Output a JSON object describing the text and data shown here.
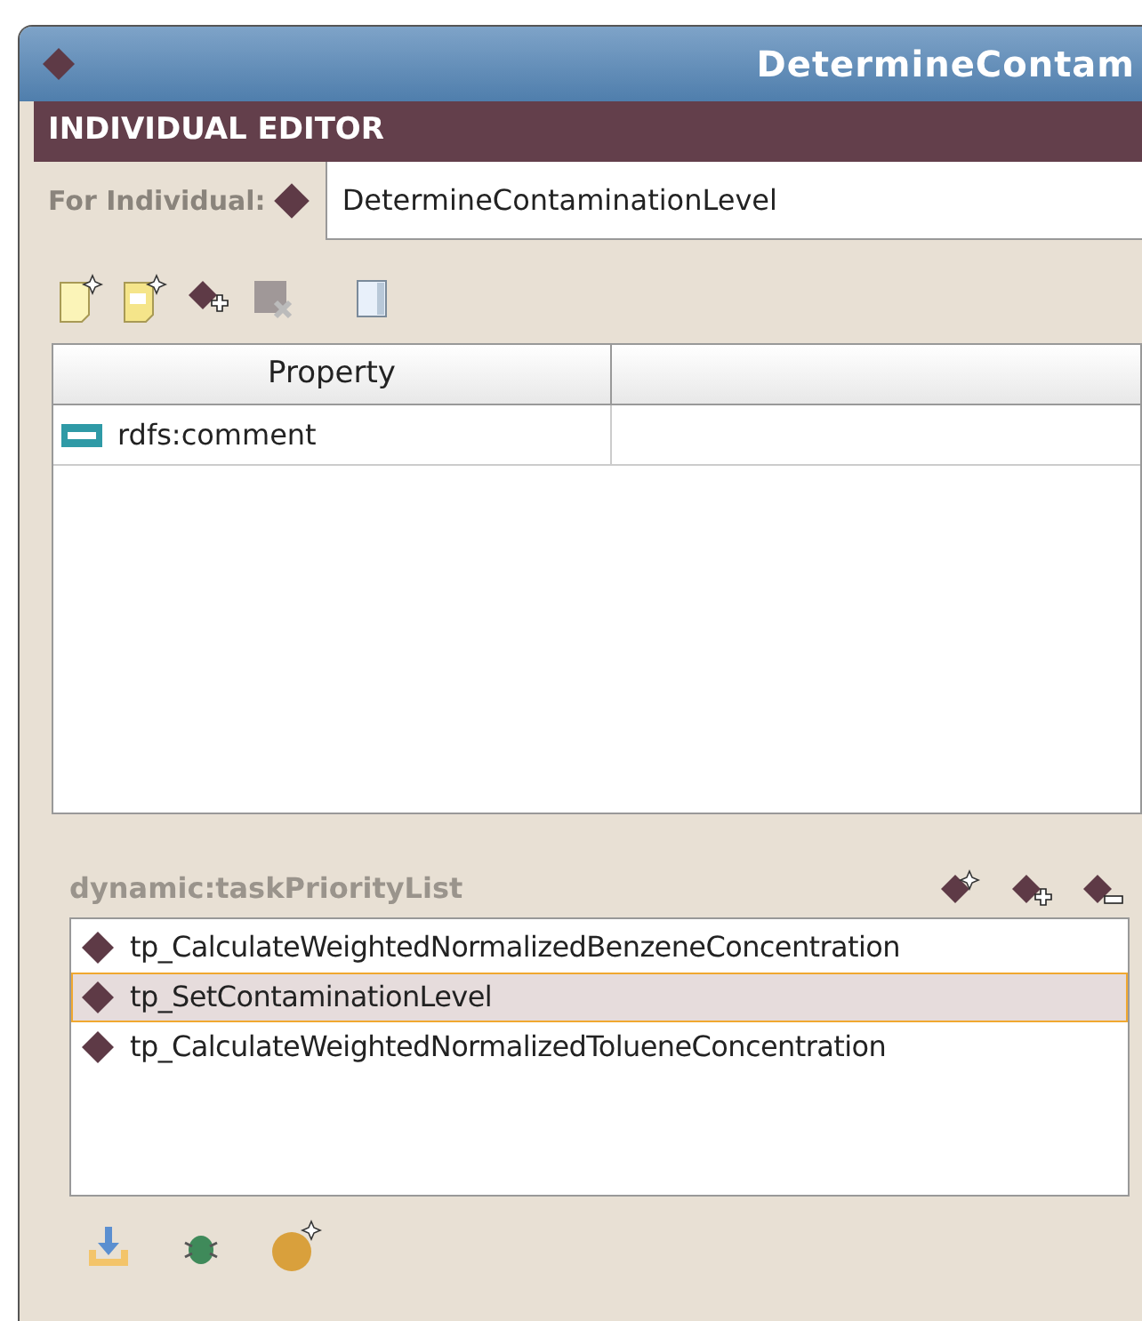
{
  "window": {
    "title": "DetermineContam"
  },
  "editor": {
    "header": "INDIVIDUAL EDITOR",
    "for_label": "For Individual:",
    "individual": "DetermineContaminationLevel"
  },
  "table": {
    "columns": [
      "Property"
    ],
    "rows": [
      {
        "property": "rdfs:comment"
      }
    ]
  },
  "list": {
    "label": "dynamic:taskPriorityList",
    "items": [
      {
        "name": "tp_CalculateWeightedNormalizedBenzeneConcentration",
        "selected": false
      },
      {
        "name": "tp_SetContaminationLevel",
        "selected": true
      },
      {
        "name": "tp_CalculateWeightedNormalizedTolueneConcentration",
        "selected": false
      }
    ]
  }
}
